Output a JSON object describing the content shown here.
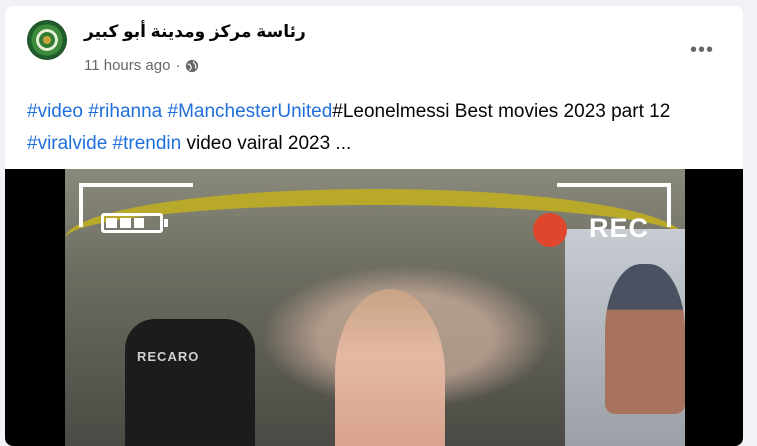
{
  "post": {
    "author": "رئاسة مركز ومدينة أبو كبير",
    "timestamp": "11 hours ago",
    "separator": "·",
    "audience_icon": "globe-icon",
    "more_label": "•••",
    "text_segments": [
      {
        "text": "#video",
        "hashtag": true
      },
      {
        "text": " ",
        "hashtag": false
      },
      {
        "text": "#rihanna",
        "hashtag": true
      },
      {
        "text": " ",
        "hashtag": false
      },
      {
        "text": "#ManchesterUnited",
        "hashtag": true
      },
      {
        "text": "#Leonelmessi Best movies 2023 part 12 ",
        "hashtag": false
      },
      {
        "text": "#viralvide",
        "hashtag": true
      },
      {
        "text": " ",
        "hashtag": false
      },
      {
        "text": "#trendin",
        "hashtag": true
      },
      {
        "text": " video vairal 2023 ...",
        "hashtag": false
      }
    ],
    "video": {
      "overlay_rec": "REC",
      "seat_brand": "RECARO",
      "battery_level": 0.75
    }
  },
  "colors": {
    "link": "#216fdb",
    "rec_dot": "#e0462b"
  }
}
